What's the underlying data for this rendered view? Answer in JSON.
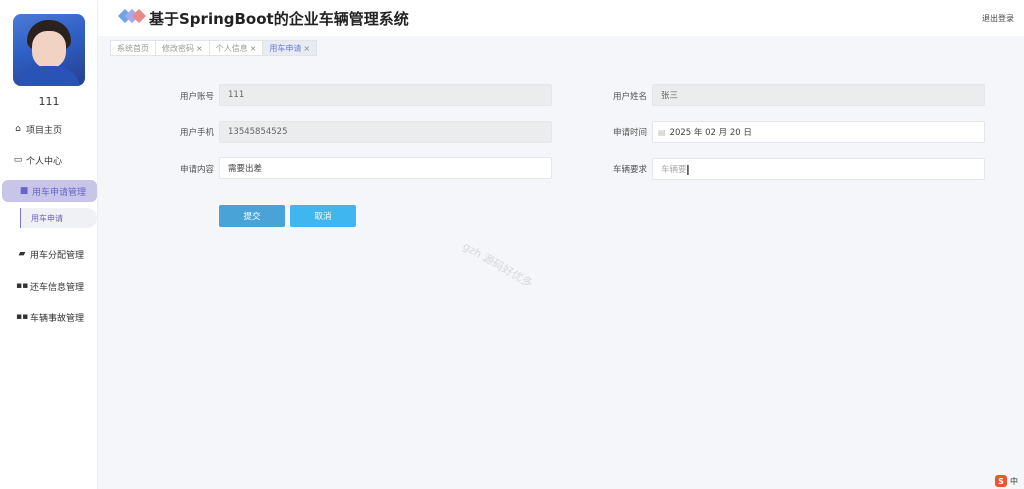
{
  "app": {
    "title": "基于SpringBoot的企业车辆管理系统",
    "logout_label": "退出登录"
  },
  "sidebar": {
    "username": "111",
    "items": [
      {
        "label": "项目主页",
        "icon": "home-icon"
      },
      {
        "label": "个人中心",
        "icon": "card-icon"
      },
      {
        "label": "用车申请管理",
        "icon": "chat-icon",
        "active": true
      },
      {
        "label": "用车分配管理",
        "icon": "wallet-icon"
      },
      {
        "label": "还车信息管理",
        "icon": "grid-icon"
      },
      {
        "label": "车辆事故管理",
        "icon": "grid-icon"
      }
    ],
    "submenu": {
      "label": "用车申请"
    }
  },
  "tabs": [
    {
      "label": "系统首页",
      "closable": false
    },
    {
      "label": "修改密码",
      "closable": true
    },
    {
      "label": "个人信息",
      "closable": true
    },
    {
      "label": "用车申请",
      "closable": true,
      "active": true
    }
  ],
  "form": {
    "account": {
      "label": "用户账号",
      "value": "111"
    },
    "name": {
      "label": "用户姓名",
      "value": "张三"
    },
    "phone": {
      "label": "用户手机",
      "value": "13545854525"
    },
    "time": {
      "label": "申请时间",
      "value": "2025 年 02 月 20 日"
    },
    "content": {
      "label": "申请内容",
      "value": "需要出差"
    },
    "vehicle": {
      "label": "车辆要求",
      "placeholder": "车辆要"
    },
    "submit_label": "提交",
    "cancel_label": "取消"
  },
  "watermark": "gzh 源码好优多",
  "ime": {
    "label": "中"
  },
  "colors": {
    "accent": "#6a64c9",
    "active_menu_bg": "#c9c5e8",
    "submit": "#4aa3d6",
    "cancel": "#40b6f1"
  }
}
